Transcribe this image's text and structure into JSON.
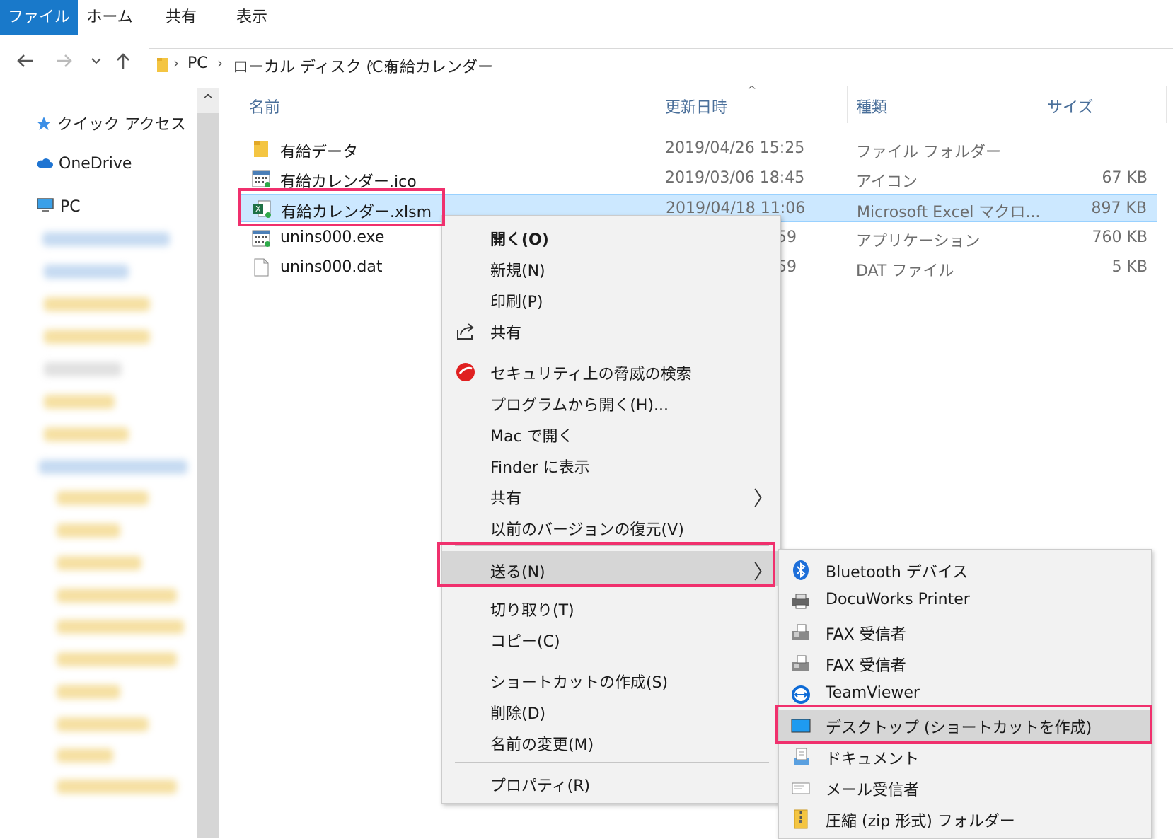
{
  "ribbon": {
    "tabs": [
      "ファイル",
      "ホーム",
      "共有",
      "表示"
    ]
  },
  "address": {
    "crumbs": [
      "PC",
      "ローカル ディスク (C:)",
      "有給カレンダー"
    ]
  },
  "nav": {
    "items": [
      {
        "label": "クイック アクセス",
        "icon": "star-icon"
      },
      {
        "label": "OneDrive",
        "icon": "cloud-icon"
      },
      {
        "label": "PC",
        "icon": "computer-icon"
      }
    ],
    "scroll_up": "^"
  },
  "columns": {
    "name": "名前",
    "date": "更新日時",
    "type": "種類",
    "size": "サイズ",
    "sort_indicator": "^"
  },
  "files": [
    {
      "name": "有給データ",
      "date": "2019/04/26 15:25",
      "type": "ファイル フォルダー",
      "size": "",
      "icon": "folder-icon"
    },
    {
      "name": "有給カレンダー.ico",
      "date": "2019/03/06 18:45",
      "type": "アイコン",
      "size": "67 KB",
      "icon": "calendar-icon"
    },
    {
      "name": "有給カレンダー.xlsm",
      "date": "2019/04/18 11:06",
      "type": "Microsoft Excel マクロ...",
      "size": "897 KB",
      "icon": "excel-icon"
    },
    {
      "name": "unins000.exe",
      "date": "59",
      "type": "アプリケーション",
      "size": "760 KB",
      "icon": "calendar-icon"
    },
    {
      "name": "unins000.dat",
      "date": "59",
      "type": "DAT ファイル",
      "size": "5 KB",
      "icon": "document-icon"
    }
  ],
  "context_menu": {
    "open": "開く(O)",
    "new": "新規(N)",
    "print": "印刷(P)",
    "share": "共有",
    "security_scan": "セキュリティ上の脅威の検索",
    "open_with": "プログラムから開く(H)...",
    "open_mac": "Mac で開く",
    "show_finder": "Finder に表示",
    "share2": "共有",
    "restore": "以前のバージョンの復元(V)",
    "send_to": "送る(N)",
    "cut": "切り取り(T)",
    "copy": "コピー(C)",
    "create_shortcut": "ショートカットの作成(S)",
    "delete": "削除(D)",
    "rename": "名前の変更(M)",
    "properties": "プロパティ(R)",
    "submenu_arrow": "〉"
  },
  "send_to_menu": {
    "bluetooth": "Bluetooth デバイス",
    "docuworks": "DocuWorks Printer",
    "fax1": "FAX 受信者",
    "fax2": "FAX 受信者",
    "teamviewer": "TeamViewer",
    "desktop": "デスクトップ (ショートカットを作成)",
    "documents": "ドキュメント",
    "mail": "メール受信者",
    "zip": "圧縮 (zip 形式) フォルダー"
  },
  "colors": {
    "accent": "#1979ca",
    "highlight": "#f0306d",
    "selection": "#cce8ff"
  }
}
